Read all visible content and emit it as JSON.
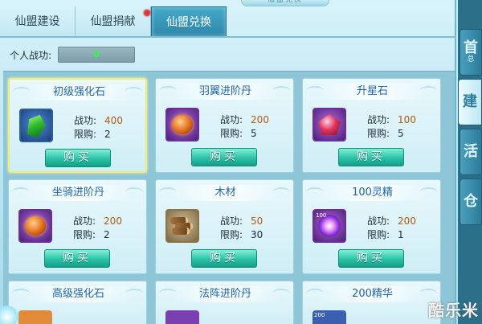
{
  "window": {
    "title_deco": "仙盟兑换"
  },
  "tabs": [
    {
      "label": "仙盟建设",
      "active": false
    },
    {
      "label": "仙盟捐献",
      "active": false,
      "badge": true
    },
    {
      "label": "仙盟兑换",
      "active": true
    }
  ],
  "merit": {
    "label": "个人战功:",
    "value": "0"
  },
  "stat_labels": {
    "cost": "战功:",
    "limit": "限购:"
  },
  "buy_label": "购买",
  "items": [
    {
      "name": "初级强化石",
      "cost": "400",
      "limit": "2",
      "icon": "green-gem-icon",
      "selected": true
    },
    {
      "name": "羽翼进阶丹",
      "cost": "200",
      "limit": "5",
      "icon": "wing-pill-icon"
    },
    {
      "name": "升星石",
      "cost": "100",
      "limit": "5",
      "icon": "red-gem-icon"
    },
    {
      "name": "坐骑进阶丹",
      "cost": "200",
      "limit": "2",
      "icon": "mount-pill-icon"
    },
    {
      "name": "木材",
      "cost": "50",
      "limit": "30",
      "icon": "wood-icon"
    },
    {
      "name": "100灵精",
      "cost": "200",
      "limit": "1",
      "icon": "spirit-orb-icon",
      "icon_text": "100"
    },
    {
      "name": "高级强化石",
      "icon": "blue-gem-icon"
    },
    {
      "name": "法阵进阶丹",
      "icon": "array-pill-icon"
    },
    {
      "name": "200精华",
      "icon": "essence-icon",
      "icon_text": "200"
    }
  ],
  "side_tabs": [
    {
      "glyph": "首",
      "sub": "总",
      "active": false
    },
    {
      "glyph": "建",
      "sub": "",
      "active": true
    },
    {
      "glyph": "活",
      "sub": "",
      "active": false
    },
    {
      "glyph": "仓",
      "sub": "",
      "active": false
    }
  ],
  "watermark": "酷乐米"
}
